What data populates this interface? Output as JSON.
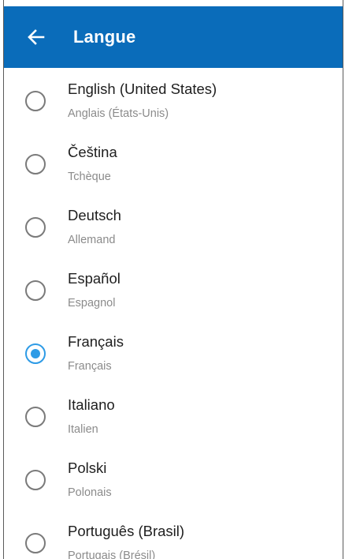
{
  "colors": {
    "app_bar": "#0a6cba",
    "accent": "#2e9be6",
    "primary_text": "#1e1e1e",
    "secondary_text": "#8b8b8b"
  },
  "header": {
    "title": "Langue",
    "back_icon": "arrow-left-icon"
  },
  "languages": [
    {
      "name": "English (United States)",
      "translation": "Anglais (États-Unis)",
      "selected": false
    },
    {
      "name": "Čeština",
      "translation": "Tchèque",
      "selected": false
    },
    {
      "name": "Deutsch",
      "translation": "Allemand",
      "selected": false
    },
    {
      "name": "Español",
      "translation": "Espagnol",
      "selected": false
    },
    {
      "name": "Français",
      "translation": "Français",
      "selected": true
    },
    {
      "name": "Italiano",
      "translation": "Italien",
      "selected": false
    },
    {
      "name": "Polski",
      "translation": "Polonais",
      "selected": false
    },
    {
      "name": "Português (Brasil)",
      "translation": "Portugais (Brésil)",
      "selected": false
    }
  ]
}
